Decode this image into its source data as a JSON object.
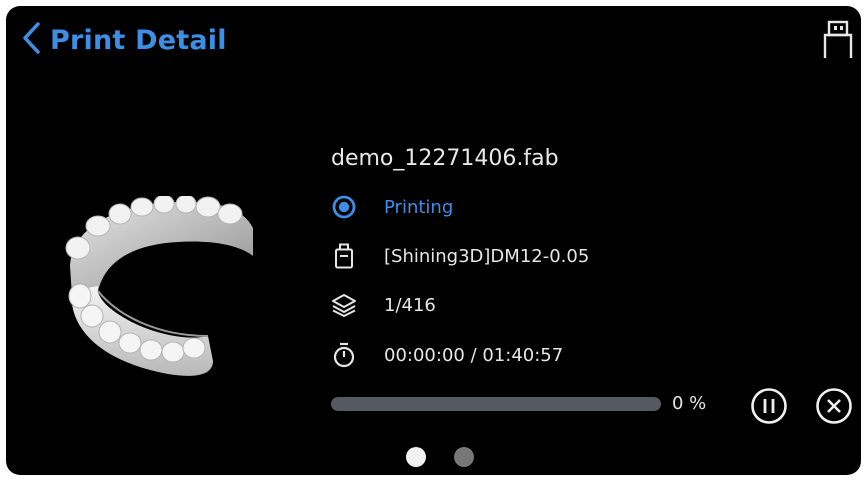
{
  "header": {
    "title": "Print Detail",
    "back_icon": "chevron-left-icon",
    "usb_icon": "usb-icon"
  },
  "job": {
    "file_name": "demo_12271406.fab",
    "status": "Printing",
    "material": "[Shining3D]DM12-0.05",
    "layers": "1/416",
    "time": "00:00:00 / 01:40:57",
    "progress_percent": 0,
    "progress_label": "0 %"
  },
  "controls": {
    "pause_icon": "pause-icon",
    "cancel_icon": "close-circle-icon"
  },
  "pagination": {
    "pages": 2,
    "active": 0
  },
  "colors": {
    "accent": "#3d8fe6",
    "background": "#000000",
    "text": "#e6e6e6",
    "track": "#555a60"
  }
}
